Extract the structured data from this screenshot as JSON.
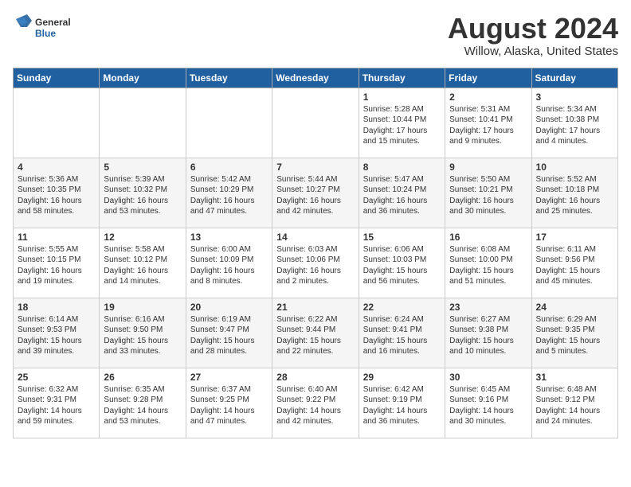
{
  "header": {
    "logo_general": "General",
    "logo_blue": "Blue",
    "month_title": "August 2024",
    "location": "Willow, Alaska, United States"
  },
  "weekdays": [
    "Sunday",
    "Monday",
    "Tuesday",
    "Wednesday",
    "Thursday",
    "Friday",
    "Saturday"
  ],
  "weeks": [
    [
      {
        "day": "",
        "info": ""
      },
      {
        "day": "",
        "info": ""
      },
      {
        "day": "",
        "info": ""
      },
      {
        "day": "",
        "info": ""
      },
      {
        "day": "1",
        "info": "Sunrise: 5:28 AM\nSunset: 10:44 PM\nDaylight: 17 hours\nand 15 minutes."
      },
      {
        "day": "2",
        "info": "Sunrise: 5:31 AM\nSunset: 10:41 PM\nDaylight: 17 hours\nand 9 minutes."
      },
      {
        "day": "3",
        "info": "Sunrise: 5:34 AM\nSunset: 10:38 PM\nDaylight: 17 hours\nand 4 minutes."
      }
    ],
    [
      {
        "day": "4",
        "info": "Sunrise: 5:36 AM\nSunset: 10:35 PM\nDaylight: 16 hours\nand 58 minutes."
      },
      {
        "day": "5",
        "info": "Sunrise: 5:39 AM\nSunset: 10:32 PM\nDaylight: 16 hours\nand 53 minutes."
      },
      {
        "day": "6",
        "info": "Sunrise: 5:42 AM\nSunset: 10:29 PM\nDaylight: 16 hours\nand 47 minutes."
      },
      {
        "day": "7",
        "info": "Sunrise: 5:44 AM\nSunset: 10:27 PM\nDaylight: 16 hours\nand 42 minutes."
      },
      {
        "day": "8",
        "info": "Sunrise: 5:47 AM\nSunset: 10:24 PM\nDaylight: 16 hours\nand 36 minutes."
      },
      {
        "day": "9",
        "info": "Sunrise: 5:50 AM\nSunset: 10:21 PM\nDaylight: 16 hours\nand 30 minutes."
      },
      {
        "day": "10",
        "info": "Sunrise: 5:52 AM\nSunset: 10:18 PM\nDaylight: 16 hours\nand 25 minutes."
      }
    ],
    [
      {
        "day": "11",
        "info": "Sunrise: 5:55 AM\nSunset: 10:15 PM\nDaylight: 16 hours\nand 19 minutes."
      },
      {
        "day": "12",
        "info": "Sunrise: 5:58 AM\nSunset: 10:12 PM\nDaylight: 16 hours\nand 14 minutes."
      },
      {
        "day": "13",
        "info": "Sunrise: 6:00 AM\nSunset: 10:09 PM\nDaylight: 16 hours\nand 8 minutes."
      },
      {
        "day": "14",
        "info": "Sunrise: 6:03 AM\nSunset: 10:06 PM\nDaylight: 16 hours\nand 2 minutes."
      },
      {
        "day": "15",
        "info": "Sunrise: 6:06 AM\nSunset: 10:03 PM\nDaylight: 15 hours\nand 56 minutes."
      },
      {
        "day": "16",
        "info": "Sunrise: 6:08 AM\nSunset: 10:00 PM\nDaylight: 15 hours\nand 51 minutes."
      },
      {
        "day": "17",
        "info": "Sunrise: 6:11 AM\nSunset: 9:56 PM\nDaylight: 15 hours\nand 45 minutes."
      }
    ],
    [
      {
        "day": "18",
        "info": "Sunrise: 6:14 AM\nSunset: 9:53 PM\nDaylight: 15 hours\nand 39 minutes."
      },
      {
        "day": "19",
        "info": "Sunrise: 6:16 AM\nSunset: 9:50 PM\nDaylight: 15 hours\nand 33 minutes."
      },
      {
        "day": "20",
        "info": "Sunrise: 6:19 AM\nSunset: 9:47 PM\nDaylight: 15 hours\nand 28 minutes."
      },
      {
        "day": "21",
        "info": "Sunrise: 6:22 AM\nSunset: 9:44 PM\nDaylight: 15 hours\nand 22 minutes."
      },
      {
        "day": "22",
        "info": "Sunrise: 6:24 AM\nSunset: 9:41 PM\nDaylight: 15 hours\nand 16 minutes."
      },
      {
        "day": "23",
        "info": "Sunrise: 6:27 AM\nSunset: 9:38 PM\nDaylight: 15 hours\nand 10 minutes."
      },
      {
        "day": "24",
        "info": "Sunrise: 6:29 AM\nSunset: 9:35 PM\nDaylight: 15 hours\nand 5 minutes."
      }
    ],
    [
      {
        "day": "25",
        "info": "Sunrise: 6:32 AM\nSunset: 9:31 PM\nDaylight: 14 hours\nand 59 minutes."
      },
      {
        "day": "26",
        "info": "Sunrise: 6:35 AM\nSunset: 9:28 PM\nDaylight: 14 hours\nand 53 minutes."
      },
      {
        "day": "27",
        "info": "Sunrise: 6:37 AM\nSunset: 9:25 PM\nDaylight: 14 hours\nand 47 minutes."
      },
      {
        "day": "28",
        "info": "Sunrise: 6:40 AM\nSunset: 9:22 PM\nDaylight: 14 hours\nand 42 minutes."
      },
      {
        "day": "29",
        "info": "Sunrise: 6:42 AM\nSunset: 9:19 PM\nDaylight: 14 hours\nand 36 minutes."
      },
      {
        "day": "30",
        "info": "Sunrise: 6:45 AM\nSunset: 9:16 PM\nDaylight: 14 hours\nand 30 minutes."
      },
      {
        "day": "31",
        "info": "Sunrise: 6:48 AM\nSunset: 9:12 PM\nDaylight: 14 hours\nand 24 minutes."
      }
    ]
  ]
}
